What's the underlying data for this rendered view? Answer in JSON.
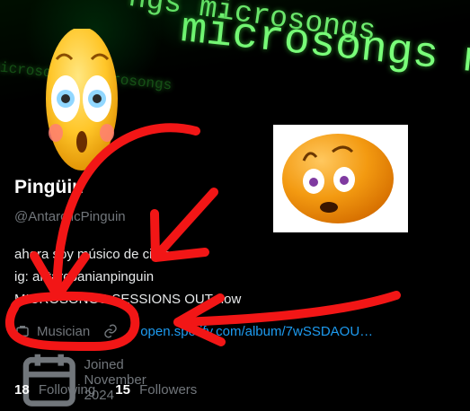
{
  "banner": {
    "text_top": "ngs microsongs",
    "text_main": "microsongs micro",
    "text_faint": "microsongs microsongs"
  },
  "profile": {
    "display_name": "Pingüin",
    "handle": "@AntarcticPinguin",
    "bio_lines": [
      "ahora soy músico de circo",
      "ig: antarcpanianpinguin",
      "MICROSONGS SESSIONS OUT now"
    ],
    "category": "Musician",
    "link_text": "open.spotify.com/album/7wSSDAOU…",
    "joined": "Joined November 2024",
    "following_count": "18",
    "following_label": "Following",
    "followers_count": "15",
    "followers_label": "Followers"
  },
  "colors": {
    "accent": "#1d9bf0",
    "scribble": "#f21616",
    "banner_text": "#7aff7a"
  },
  "icons": {
    "category": "briefcase-icon",
    "link": "link-icon",
    "joined": "calendar-icon"
  }
}
